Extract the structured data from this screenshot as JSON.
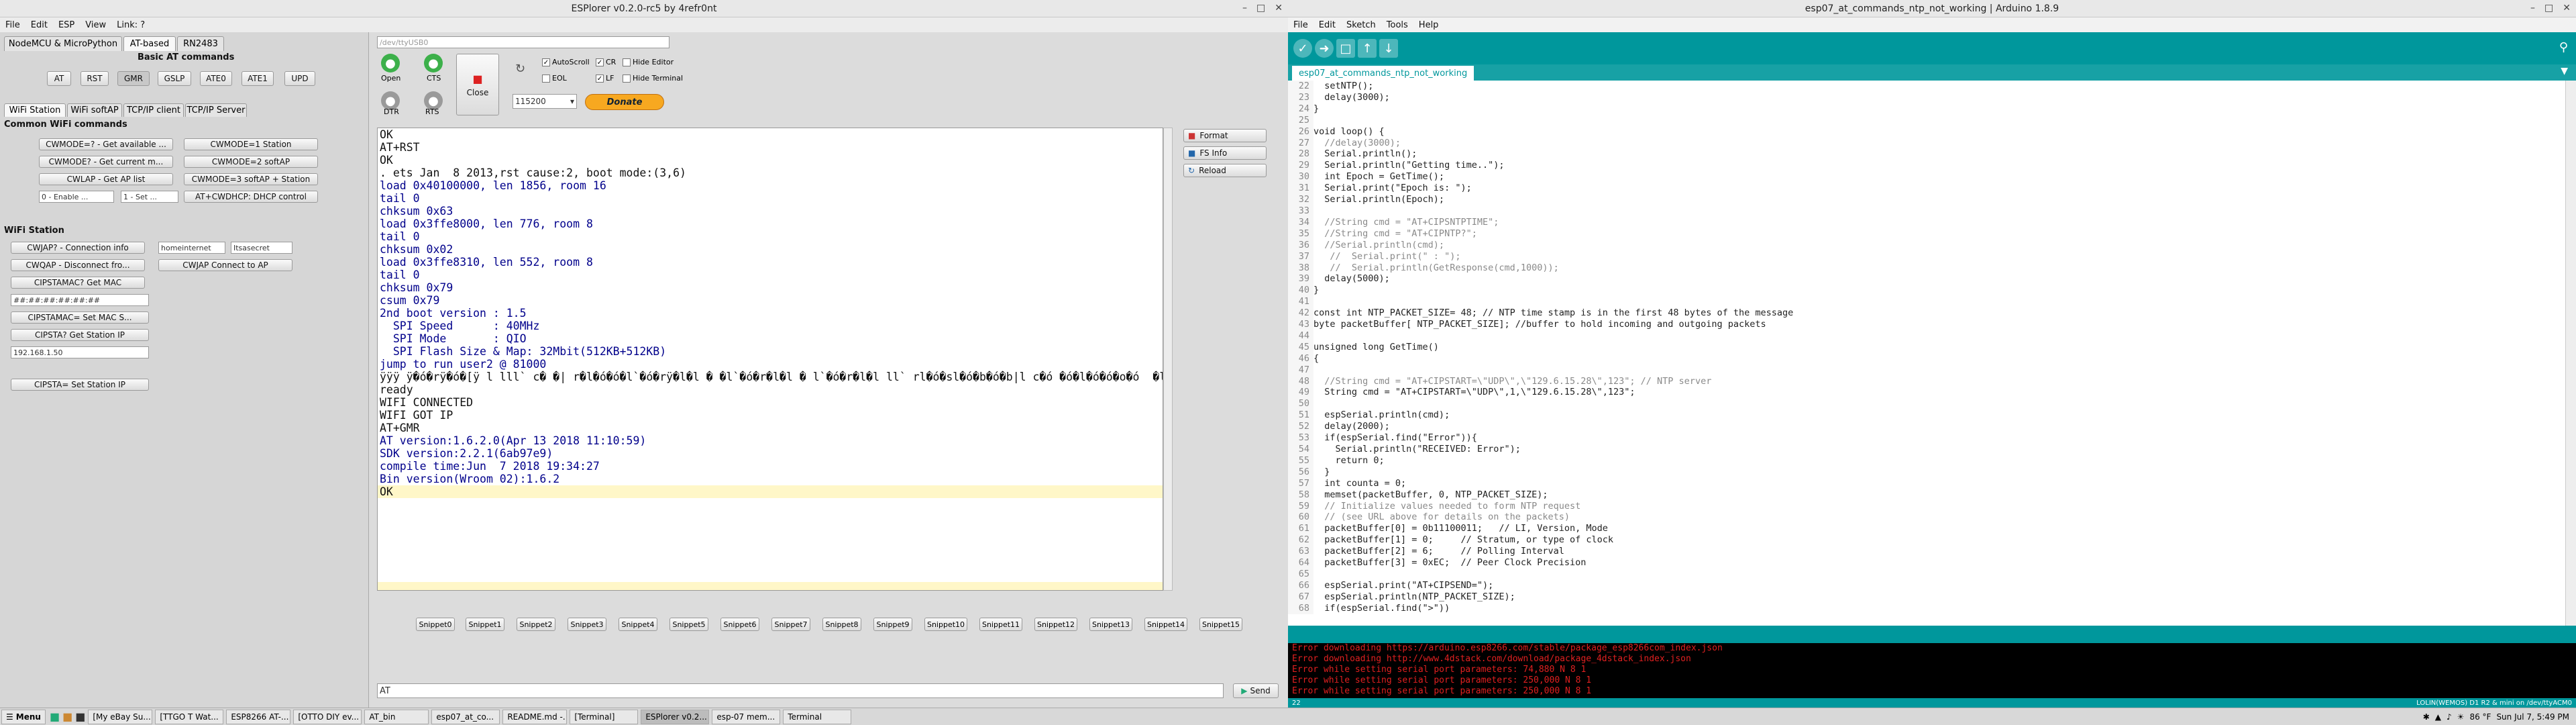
{
  "esplorer": {
    "title": "ESPlorer v0.2.0-rc5 by 4refr0nt",
    "menu": [
      "File",
      "Edit",
      "ESP",
      "View",
      "Link: ?"
    ],
    "fw_tabs": [
      "NodeMCU & MicroPython",
      "AT-based",
      "RN2483"
    ],
    "basic_title": "Basic AT commands",
    "basic_btns": [
      "AT",
      "RST",
      "GMR",
      "GSLP",
      "ATE0",
      "ATE1",
      "UPD"
    ],
    "wifi_tabs": [
      "WiFi Station",
      "WiFi softAP",
      "TCP/IP client",
      "TCP/IP Server"
    ],
    "common_title": "Common WiFi commands",
    "common_btns": [
      "CWMODE=? - Get available ...",
      "CWMODE=1 Station",
      "CWMODE? - Get current m...",
      "CWMODE=2 softAP",
      "CWLAP - Get AP list",
      "CWMODE=3 softAP + Station",
      "0 - Enable ...",
      "1 - Set ...",
      "AT+CWDHCP: DHCP control"
    ],
    "station_title": "WiFi Station",
    "station_btns": [
      "CWJAP? - Connection info",
      "CWQAP - Disconnect fro...",
      "CWJAP Connect to AP",
      "CIPSTAMAC? Get MAC",
      "CIPSTAMAC= Set MAC S...",
      "CIPSTA? Get Station IP",
      "CIPSTA= Set Station IP"
    ],
    "ssid": "homeinternet",
    "pass": "Itsasecret",
    "mac": "##:##:##:##:##:##",
    "ip": "192.168.1.50",
    "port_label": "/dev/ttyUSB0",
    "btn_open": "Open",
    "btn_cts": "CTS",
    "btn_close": "Close",
    "btn_dtr": "DTR",
    "btn_rts": "RTS",
    "baud": "115200",
    "donate": "Donate",
    "checks": [
      "AutoScroll",
      "CR",
      "Hide Editor",
      "EOL",
      "LF",
      "Hide Terminal"
    ],
    "side_btns": [
      "Format",
      "FS Info",
      "Reload"
    ],
    "terminal": [
      "",
      "OK",
      "AT+RST",
      "",
      "OK",
      "",
      ". ets Jan  8 2013,rst cause:2, boot mode:(3,6)",
      "",
      "load 0x40100000, len 1856, room 16",
      "tail 0",
      "chksum 0x63",
      "load 0x3ffe8000, len 776, room 8",
      "tail 0",
      "chksum 0x02",
      "load 0x3ffe8310, len 552, room 8",
      "tail 0",
      "chksum 0x79",
      "csum 0x79",
      "",
      "2nd boot version : 1.5",
      "  SPI Speed      : 40MHz",
      "  SPI Mode       : QIO",
      "  SPI Flash Size & Map: 32Mbit(512KB+512KB)",
      "jump to run user2 @ 81000",
      "",
      "ÿÿÿ ÿ�ó�rÿ�ó�[ÿ l lll` c� �| r�l�ó�ó�l`�ó�rÿ�l�l � �l`�ó�r�l�l � l`�ó�r�l�l ll` rl�ó�sl�ó�b�ó�b|l c�ó �ó�l�ó�ó�o�ó  �l�|",
      "ready",
      "WIFI CONNECTED",
      "WIFI GOT IP",
      "AT+GMR",
      "AT version:1.6.2.0(Apr 13 2018 11:10:59)",
      "SDK version:2.2.1(6ab97e9)",
      "compile time:Jun  7 2018 19:34:27",
      "Bin version(Wroom 02):1.6.2",
      "OK"
    ],
    "snippets": [
      "Snippet0",
      "Snippet1",
      "Snippet2",
      "Snippet3",
      "Snippet4",
      "Snippet5",
      "Snippet6",
      "Snippet7",
      "Snippet8",
      "Snippet9",
      "Snippet10",
      "Snippet11",
      "Snippet12",
      "Snippet13",
      "Snippet14",
      "Snippet15"
    ],
    "cmd": "AT",
    "send": "Send"
  },
  "arduino": {
    "title": "esp07_at_commands_ntp_not_working | Arduino 1.8.9",
    "menu": [
      "File",
      "Edit",
      "Sketch",
      "Tools",
      "Help"
    ],
    "tab": "esp07_at_commands_ntp_not_working",
    "code": [
      [
        "22",
        "  setNTP();"
      ],
      [
        "23",
        "  delay(3000);"
      ],
      [
        "24",
        "}"
      ],
      [
        "25",
        ""
      ],
      [
        "26",
        "void loop() {"
      ],
      [
        "27",
        "  //delay(3000);"
      ],
      [
        "28",
        "  Serial.println();"
      ],
      [
        "29",
        "  Serial.println(\"Getting time..\");"
      ],
      [
        "30",
        "  int Epoch = GetTime();"
      ],
      [
        "31",
        "  Serial.print(\"Epoch is: \");"
      ],
      [
        "32",
        "  Serial.println(Epoch);"
      ],
      [
        "33",
        ""
      ],
      [
        "34",
        "  //String cmd = \"AT+CIPSNTPTIME\";"
      ],
      [
        "35",
        "  //String cmd = \"AT+CIPNTP?\";"
      ],
      [
        "36",
        "  //Serial.println(cmd);"
      ],
      [
        "37",
        "   //  Serial.print(\" : \");"
      ],
      [
        "38",
        "   //  Serial.println(GetResponse(cmd,1000));"
      ],
      [
        "39",
        "  delay(5000);"
      ],
      [
        "40",
        "}"
      ],
      [
        "41",
        ""
      ],
      [
        "42",
        "const int NTP_PACKET_SIZE= 48; // NTP time stamp is in the first 48 bytes of the message"
      ],
      [
        "43",
        "byte packetBuffer[ NTP_PACKET_SIZE]; //buffer to hold incoming and outgoing packets"
      ],
      [
        "44",
        ""
      ],
      [
        "45",
        "unsigned long GetTime()"
      ],
      [
        "46",
        "{"
      ],
      [
        "47",
        ""
      ],
      [
        "48",
        "  //String cmd = \"AT+CIPSTART=\\\"UDP\\\",\\\"129.6.15.28\\\",123\"; // NTP server"
      ],
      [
        "49",
        "  String cmd = \"AT+CIPSTART=\\\"UDP\\\",1,\\\"129.6.15.28\\\",123\";"
      ],
      [
        "50",
        ""
      ],
      [
        "51",
        "  espSerial.println(cmd);"
      ],
      [
        "52",
        "  delay(2000);"
      ],
      [
        "53",
        "  if(espSerial.find(\"Error\")){"
      ],
      [
        "54",
        "    Serial.println(\"RECEIVED: Error\");"
      ],
      [
        "55",
        "    return 0;"
      ],
      [
        "56",
        "  }"
      ],
      [
        "57",
        "  int counta = 0;"
      ],
      [
        "58",
        "  memset(packetBuffer, 0, NTP_PACKET_SIZE);"
      ],
      [
        "59",
        "  // Initialize values needed to form NTP request"
      ],
      [
        "60",
        "  // (see URL above for details on the packets)"
      ],
      [
        "61",
        "  packetBuffer[0] = 0b11100011;   // LI, Version, Mode"
      ],
      [
        "62",
        "  packetBuffer[1] = 0;     // Stratum, or type of clock"
      ],
      [
        "63",
        "  packetBuffer[2] = 6;     // Polling Interval"
      ],
      [
        "64",
        "  packetBuffer[3] = 0xEC;  // Peer Clock Precision"
      ],
      [
        "65",
        ""
      ],
      [
        "66",
        "  espSerial.print(\"AT+CIPSEND=\");"
      ],
      [
        "67",
        "  espSerial.println(NTP_PACKET_SIZE);"
      ],
      [
        "68",
        "  if(espSerial.find(\">\"))"
      ]
    ],
    "console": [
      "Error downloading https://arduino.esp8266.com/stable/package_esp8266com_index.json",
      "Error downloading http://www.4dstack.com/download/package_4dstack_index.json",
      "Error while setting serial port parameters: 74,880 N 8 1",
      "Error while setting serial port parameters: 250,000 N 8 1",
      "Error while setting serial port parameters: 250,000 N 8 1"
    ],
    "status_line": "22",
    "status_board": "LOLIN(WEMOS) D1 R2 & mini on /dev/ttyACM0"
  },
  "taskbar": {
    "menu": "Menu",
    "items": [
      "[My eBay Su...",
      "[TTGO T Wat...",
      "ESP8266 AT-...",
      "[OTTO DIY ev...",
      "AT_bin",
      "esp07_at_co...",
      "README.md -...",
      "[Terminal]",
      "ESPlorer v0.2...",
      "esp-07 mem...",
      "Terminal"
    ],
    "active": 8,
    "weather": "86 °F",
    "clock": "Sun Jul 7, 5:49 PM"
  },
  "colors": {
    "arduino_teal": "#00979c",
    "esp_bg": "#dcdcdc",
    "console_red": "#e02020",
    "green_led": "#3cb04a",
    "donate": "#f7a820"
  }
}
